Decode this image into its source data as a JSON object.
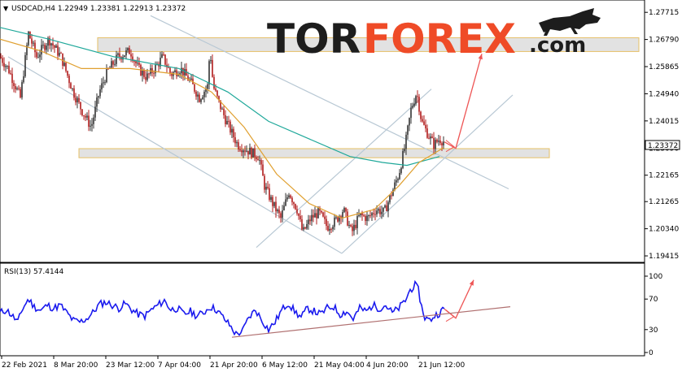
{
  "chart_data": [
    {
      "type": "candlestick",
      "symbol_header": "USDCAD,H4  1.22949 1.23381 1.22913 1.23372",
      "y_axis_ticks": [
        "1.27715",
        "1.26790",
        "1.25865",
        "1.24940",
        "1.24015",
        "1.23090",
        "1.22165",
        "1.21265",
        "1.20340",
        "1.19415"
      ],
      "y_axis_tick_values": [
        1.27715,
        1.2679,
        1.25865,
        1.2494,
        1.24015,
        1.2309,
        1.22165,
        1.21265,
        1.2034,
        1.19415
      ],
      "ylim": [
        1.1925,
        1.2808
      ],
      "current_price_label": "1.23372",
      "current_price": 1.23372,
      "x_axis_labels": [
        "22 Feb 2021",
        "8 Mar 20:00",
        "23 Mar 12:00",
        "7 Apr 04:00",
        "21 Apr 20:00",
        "6 May 12:00",
        "21 May 04:00",
        "4 Jun 20:00",
        "21 Jun 12:00"
      ],
      "price_path": [
        [
          0,
          1.262
        ],
        [
          10,
          1.258
        ],
        [
          25,
          1.248
        ],
        [
          35,
          1.27
        ],
        [
          45,
          1.262
        ],
        [
          60,
          1.268
        ],
        [
          75,
          1.262
        ],
        [
          90,
          1.25
        ],
        [
          100,
          1.244
        ],
        [
          112,
          1.238
        ],
        [
          122,
          1.25
        ],
        [
          132,
          1.257
        ],
        [
          145,
          1.262
        ],
        [
          160,
          1.264
        ],
        [
          170,
          1.258
        ],
        [
          180,
          1.255
        ],
        [
          190,
          1.258
        ],
        [
          200,
          1.262
        ],
        [
          210,
          1.256
        ],
        [
          222,
          1.258
        ],
        [
          235,
          1.253
        ],
        [
          245,
          1.248
        ],
        [
          255,
          1.252
        ],
        [
          258,
          1.265
        ],
        [
          262,
          1.252
        ],
        [
          268,
          1.247
        ],
        [
          278,
          1.24
        ],
        [
          285,
          1.236
        ],
        [
          292,
          1.232
        ],
        [
          305,
          1.23
        ],
        [
          318,
          1.228
        ],
        [
          325,
          1.218
        ],
        [
          335,
          1.212
        ],
        [
          345,
          1.207
        ],
        [
          355,
          1.216
        ],
        [
          365,
          1.21
        ],
        [
          372,
          1.202
        ],
        [
          382,
          1.207
        ],
        [
          392,
          1.209
        ],
        [
          402,
          1.204
        ],
        [
          412,
          1.206
        ],
        [
          422,
          1.21
        ],
        [
          432,
          1.202
        ],
        [
          442,
          1.208
        ],
        [
          452,
          1.207
        ],
        [
          462,
          1.21
        ],
        [
          472,
          1.209
        ],
        [
          482,
          1.216
        ],
        [
          490,
          1.222
        ],
        [
          498,
          1.232
        ],
        [
          505,
          1.244
        ],
        [
          512,
          1.25
        ],
        [
          518,
          1.24
        ],
        [
          525,
          1.236
        ],
        [
          533,
          1.232
        ],
        [
          540,
          1.234
        ],
        [
          546,
          1.233
        ]
      ],
      "moving_averages": [
        {
          "color": "#1fa89a",
          "points": [
            [
              0,
              1.272
            ],
            [
              60,
              1.268
            ],
            [
              140,
              1.262
            ],
            [
              220,
              1.258
            ],
            [
              280,
              1.25
            ],
            [
              330,
              1.24
            ],
            [
              380,
              1.234
            ],
            [
              430,
              1.228
            ],
            [
              470,
              1.226
            ],
            [
              500,
              1.225
            ],
            [
              540,
              1.228
            ]
          ]
        },
        {
          "color": "#e0a030",
          "points": [
            [
              0,
              1.268
            ],
            [
              50,
              1.264
            ],
            [
              100,
              1.258
            ],
            [
              160,
              1.258
            ],
            [
              220,
              1.256
            ],
            [
              260,
              1.25
            ],
            [
              300,
              1.238
            ],
            [
              340,
              1.222
            ],
            [
              380,
              1.212
            ],
            [
              420,
              1.207
            ],
            [
              460,
              1.21
            ],
            [
              490,
              1.218
            ],
            [
              515,
              1.226
            ],
            [
              545,
              1.231
            ]
          ]
        }
      ],
      "channels": [
        {
          "color": "#b8c8d4",
          "points": [
            [
              10,
              1.262
            ],
            [
              420,
              1.195
            ]
          ]
        },
        {
          "color": "#b8c8d4",
          "points": [
            [
              185,
              1.276
            ],
            [
              625,
              1.217
            ]
          ]
        },
        {
          "color": "#b8c8d4",
          "points": [
            [
              315,
              1.197
            ],
            [
              530,
              1.251
            ]
          ]
        },
        {
          "color": "#b8c8d4",
          "points": [
            [
              420,
              1.195
            ],
            [
              630,
              1.249
            ]
          ]
        }
      ],
      "zones": [
        {
          "x": [
            120,
            785
          ],
          "y": [
            1.2685,
            1.2638
          ],
          "fill": "#dddddd",
          "stroke": "#e6c067"
        },
        {
          "x": [
            97,
            675
          ],
          "y": [
            1.2307,
            1.2276
          ],
          "fill": "#dddddd",
          "stroke": "#e6c067"
        }
      ],
      "forecast_arrows": [
        {
          "color": "#ee5555",
          "points": [
            [
              546,
              1.233
            ],
            [
              560,
              1.2308
            ],
            [
              592,
              1.263
            ]
          ]
        }
      ]
    },
    {
      "type": "line",
      "indicator_header": "RSI(13) 57.4144",
      "y_axis_ticks": [
        "100",
        "70",
        "30",
        "0"
      ],
      "y_axis_tick_values": [
        100,
        70,
        30,
        0
      ],
      "ylim": [
        0,
        100
      ],
      "series": [
        {
          "color": "#1a1aee",
          "points": [
            [
              0,
              52
            ],
            [
              8,
              56
            ],
            [
              15,
              48
            ],
            [
              22,
              40
            ],
            [
              28,
              58
            ],
            [
              35,
              70
            ],
            [
              42,
              60
            ],
            [
              50,
              55
            ],
            [
              58,
              62
            ],
            [
              66,
              58
            ],
            [
              74,
              62
            ],
            [
              82,
              52
            ],
            [
              90,
              42
            ],
            [
              98,
              40
            ],
            [
              106,
              44
            ],
            [
              114,
              52
            ],
            [
              122,
              63
            ],
            [
              130,
              66
            ],
            [
              138,
              62
            ],
            [
              146,
              58
            ],
            [
              154,
              64
            ],
            [
              162,
              56
            ],
            [
              170,
              50
            ],
            [
              178,
              48
            ],
            [
              186,
              56
            ],
            [
              194,
              62
            ],
            [
              202,
              68
            ],
            [
              210,
              56
            ],
            [
              218,
              58
            ],
            [
              226,
              50
            ],
            [
              234,
              54
            ],
            [
              242,
              48
            ],
            [
              250,
              52
            ],
            [
              258,
              60
            ],
            [
              266,
              56
            ],
            [
              274,
              46
            ],
            [
              282,
              36
            ],
            [
              290,
              24
            ],
            [
              298,
              28
            ],
            [
              306,
              46
            ],
            [
              314,
              56
            ],
            [
              322,
              42
            ],
            [
              330,
              30
            ],
            [
              338,
              40
            ],
            [
              346,
              55
            ],
            [
              354,
              65
            ],
            [
              362,
              54
            ],
            [
              370,
              46
            ],
            [
              378,
              58
            ],
            [
              386,
              54
            ],
            [
              394,
              50
            ],
            [
              402,
              58
            ],
            [
              410,
              60
            ],
            [
              418,
              50
            ],
            [
              426,
              54
            ],
            [
              434,
              44
            ],
            [
              442,
              58
            ],
            [
              450,
              54
            ],
            [
              458,
              62
            ],
            [
              466,
              58
            ],
            [
              474,
              62
            ],
            [
              482,
              52
            ],
            [
              490,
              58
            ],
            [
              498,
              68
            ],
            [
              504,
              82
            ],
            [
              510,
              88
            ],
            [
              514,
              82
            ],
            [
              518,
              60
            ],
            [
              522,
              46
            ],
            [
              528,
              42
            ],
            [
              534,
              48
            ],
            [
              540,
              52
            ],
            [
              546,
              57.4
            ]
          ]
        }
      ],
      "trendlines": [
        {
          "color": "#b07070",
          "points": [
            [
              285,
              20
            ],
            [
              627,
              60
            ]
          ]
        }
      ],
      "forecast_arrows": [
        {
          "color": "#ee5555",
          "points": [
            [
              546,
              57
            ],
            [
              560,
              45
            ],
            [
              582,
              95
            ]
          ]
        }
      ]
    }
  ],
  "watermark": {
    "text_left": "TOR",
    "text_right": "FOREX",
    "suffix": ".com"
  },
  "colors": {
    "bull": "#333333",
    "bear": "#b01c1c",
    "rsi": "#1a1aee",
    "wm_dark": "#1d1d1d",
    "wm_accent": "#ef4b27"
  }
}
